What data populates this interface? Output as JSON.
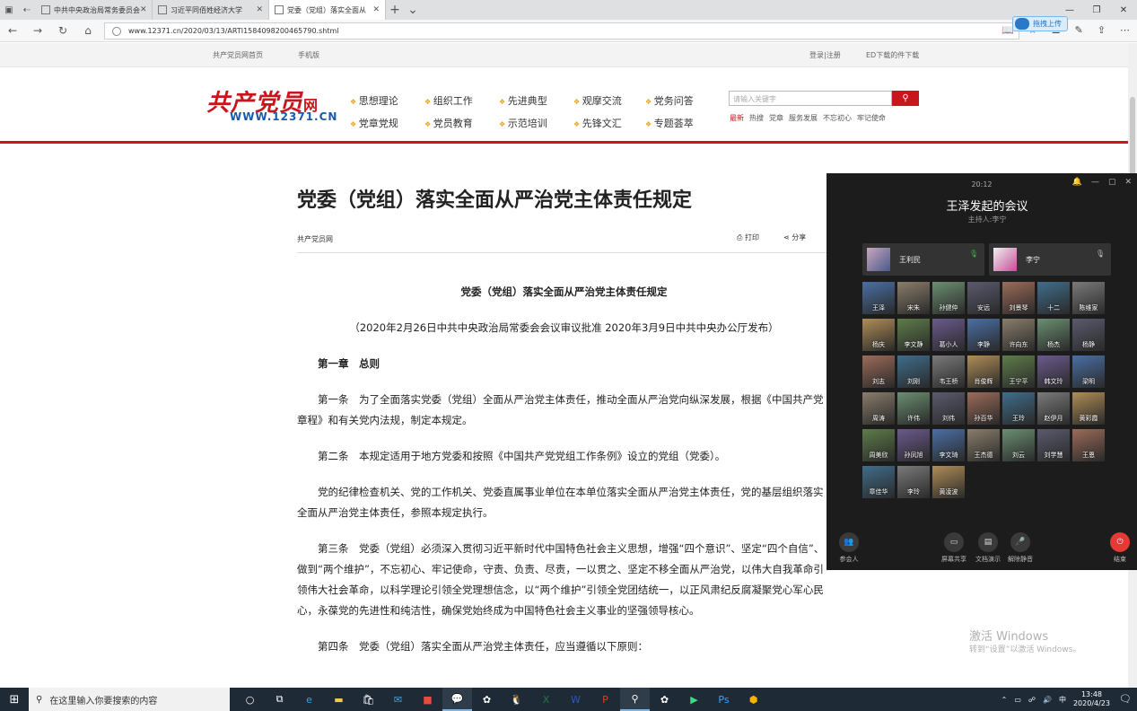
{
  "browser": {
    "tabs": [
      {
        "title": "中共中央政治局常务委员会"
      },
      {
        "title": "习近平同佰姓经济大学"
      },
      {
        "title": "党委（党组）落实全面从",
        "active": true
      }
    ],
    "url": "www.12371.cn/2020/03/13/ARTI1584098200465790.shtml",
    "upload_label": "拖拽上传"
  },
  "site": {
    "top_left_home": "共产党员网首页",
    "top_left_mobile": "手机版",
    "top_right_login": "登录|注册",
    "top_right_download": "ED下载的件下载",
    "logo": "共产党员",
    "logo_suffix": "网",
    "logo_url": "WWW.12371.CN",
    "nav": [
      "思想理论",
      "组织工作",
      "先进典型",
      "观摩交流",
      "党务问答",
      "党章党规",
      "党员教育",
      "示范培训",
      "先锋文汇",
      "专题荟萃"
    ],
    "search_placeholder": "请输入关键字",
    "hot_links": [
      "最新",
      "热搜",
      "党章",
      "服务发展",
      "不忘初心",
      "牢记使命"
    ]
  },
  "article": {
    "title": "党委（党组）落实全面从严治党主体责任规定",
    "source": "共产党员网",
    "print_label": "打印",
    "share_label": "分享",
    "subtitle": "党委（党组）落实全面从严治党主体责任规定",
    "publish_note": "（2020年2月26日中共中央政治局常委会会议审议批准 2020年3月9日中共中央办公厅发布）",
    "chapter": "第一章　总则",
    "paragraphs": [
      "第一条　为了全面落实党委（党组）全面从严治党主体责任，推动全面从严治党向纵深发展，根据《中国共产党章程》和有关党内法规，制定本规定。",
      "第二条　本规定适用于地方党委和按照《中国共产党党组工作条例》设立的党组（党委）。",
      "党的纪律检查机关、党的工作机关、党委直属事业单位在本单位落实全面从严治党主体责任，党的基层组织落实全面从严治党主体责任，参照本规定执行。",
      "第三条　党委（党组）必须深入贯彻习近平新时代中国特色社会主义思想，增强“四个意识”、坚定“四个自信”、做到“两个维护”，不忘初心、牢记使命，守责、负责、尽责，一以贯之、坚定不移全面从严治党，以伟大自我革命引领伟大社会革命，以科学理论引领全党理想信念，以“两个维护”引领全党团结统一，以正风肃纪反腐凝聚党心军心民心，永葆党的先进性和纯洁性，确保党始终成为中国特色社会主义事业的坚强领导核心。",
      "第四条　党委（党组）落实全面从严治党主体责任，应当遵循以下原则："
    ]
  },
  "meeting": {
    "time": "20:12",
    "title": "王泽发起的会议",
    "host": "主持人:李宁",
    "main_tiles": [
      {
        "name": "王利民"
      },
      {
        "name": "李宁"
      }
    ],
    "participants": [
      "王泽",
      "宋朱",
      "孙健仲",
      "安远",
      "刘景琴",
      "十二",
      "陈维家",
      "杨庆",
      "李文静",
      "葛小人",
      "李静",
      "许向东",
      "杨杰",
      "杨静",
      "刘志",
      "刘刚",
      "韦王桥",
      "肖俊辉",
      "王宁平",
      "韩文玲",
      "梁明",
      "周涛",
      "许伟",
      "刘伟",
      "孙百华",
      "王玲",
      "赵伊月",
      "黄彩霞",
      "周美欣",
      "孙凤旭",
      "李文琦",
      "王杰德",
      "刘云",
      "刘学慧",
      "王恩",
      "章佳华",
      "李玲",
      "黄凌波"
    ],
    "buttons": {
      "members": "参会人",
      "screen_share": "屏幕共享",
      "doc_share": "文档演示",
      "mute": "解除静音",
      "end": "结束"
    }
  },
  "windows_watermark": {
    "line1": "激活 Windows",
    "line2": "转到“设置”以激活 Windows。"
  },
  "taskbar": {
    "search_placeholder": "在这里输入你要搜索的内容",
    "ime": "中",
    "time": "13:48",
    "date": "2020/4/23"
  }
}
